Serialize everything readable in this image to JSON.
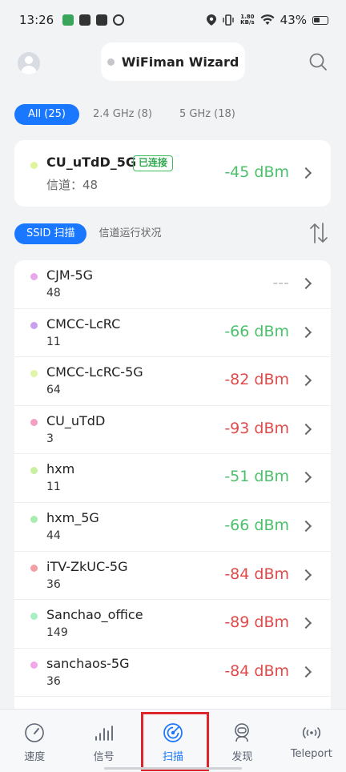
{
  "status_bar": {
    "time": "13:26",
    "speed_value": "1.80",
    "speed_unit": "KB/s",
    "battery": "43%"
  },
  "header": {
    "title": "WiFiman Wizard"
  },
  "band_tabs": [
    {
      "label": "All (25)",
      "active": true
    },
    {
      "label": "2.4 GHz (8)",
      "active": false
    },
    {
      "label": "5 GHz (18)",
      "active": false
    }
  ],
  "connected": {
    "ssid": "CU_uTdD_5G",
    "badge": "已连接",
    "channel": "信道：48",
    "signal": "-45 dBm",
    "dot_color": "#dff59a",
    "signal_color": "#4cc16b"
  },
  "view_tabs": [
    {
      "label": "SSID 扫描",
      "active": true
    },
    {
      "label": "信道运行状况",
      "active": false
    }
  ],
  "networks": [
    {
      "ssid": "CJM-5G",
      "channel": "48",
      "signal": "---",
      "dot_color": "#e9a7ee",
      "signal_color": "#b9bcc1"
    },
    {
      "ssid": "CMCC-LcRC",
      "channel": "11",
      "signal": "-66 dBm",
      "dot_color": "#c9a0f0",
      "signal_color": "#4cc16b"
    },
    {
      "ssid": "CMCC-LcRC-5G",
      "channel": "64",
      "signal": "-82 dBm",
      "dot_color": "#dff5a8",
      "signal_color": "#e14a4a"
    },
    {
      "ssid": "CU_uTdD",
      "channel": "3",
      "signal": "-93 dBm",
      "dot_color": "#f2a0c4",
      "signal_color": "#e14a4a"
    },
    {
      "ssid": "hxm",
      "channel": "11",
      "signal": "-51 dBm",
      "dot_color": "#c8f0a0",
      "signal_color": "#4cc16b"
    },
    {
      "ssid": "hxm_5G",
      "channel": "44",
      "signal": "-66 dBm",
      "dot_color": "#a8ecae",
      "signal_color": "#4cc16b"
    },
    {
      "ssid": "iTV-ZkUC-5G",
      "channel": "36",
      "signal": "-84 dBm",
      "dot_color": "#f2a0a6",
      "signal_color": "#e14a4a"
    },
    {
      "ssid": "Sanchao_office",
      "channel": "149",
      "signal": "-89 dBm",
      "dot_color": "#a8f0c4",
      "signal_color": "#e14a4a"
    },
    {
      "ssid": "sanchaos-5G",
      "channel": "36",
      "signal": "-84 dBm",
      "dot_color": "#f0a8ea",
      "signal_color": "#e14a4a"
    }
  ],
  "bottom_nav": [
    {
      "label": "速度",
      "icon": "speedometer-icon",
      "active": false
    },
    {
      "label": "信号",
      "icon": "signal-bars-icon",
      "active": false
    },
    {
      "label": "扫描",
      "icon": "radar-scan-icon",
      "active": true
    },
    {
      "label": "发现",
      "icon": "discover-robot-icon",
      "active": false
    },
    {
      "label": "Teleport",
      "icon": "teleport-icon",
      "active": false
    }
  ],
  "colors": {
    "accent": "#1a77ff",
    "highlight": "#e0242c"
  }
}
